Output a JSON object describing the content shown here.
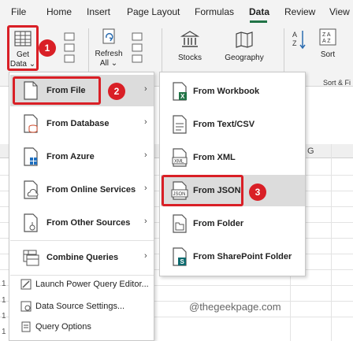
{
  "ribbon_tabs": {
    "file": "File",
    "home": "Home",
    "insert": "Insert",
    "page_layout": "Page Layout",
    "formulas": "Formulas",
    "data": "Data",
    "review": "Review",
    "view": "View"
  },
  "ribbon": {
    "get_data_line1": "Get",
    "get_data_line2": "Data",
    "refresh_line1": "Refresh",
    "refresh_line2": "All",
    "stocks": "Stocks",
    "geography": "Geography",
    "sort": "Sort",
    "sort_group_label": "Sort & Fi"
  },
  "columns": {
    "g": "G"
  },
  "menu_left": {
    "from_file": "From File",
    "from_database": "From Database",
    "from_azure": "From Azure",
    "from_online_services": "From Online Services",
    "from_other_sources": "From Other Sources",
    "combine_queries": "Combine Queries",
    "launch_pq_editor": "Launch Power Query Editor...",
    "data_source_settings": "Data Source Settings...",
    "query_options": "Query Options"
  },
  "menu_right": {
    "from_workbook": "From Workbook",
    "from_text_csv": "From Text/CSV",
    "from_xml": "From XML",
    "from_json": "From JSON",
    "from_folder": "From Folder",
    "from_sharepoint_folder": "From SharePoint Folder"
  },
  "icons": {
    "json_text": "JSON",
    "xml_text": "XML"
  },
  "badges": {
    "one": "1",
    "two": "2",
    "three": "3"
  },
  "watermark": "@thegeekpage.com",
  "colors": {
    "excel_green": "#217346",
    "highlight_red": "#d91f26"
  }
}
